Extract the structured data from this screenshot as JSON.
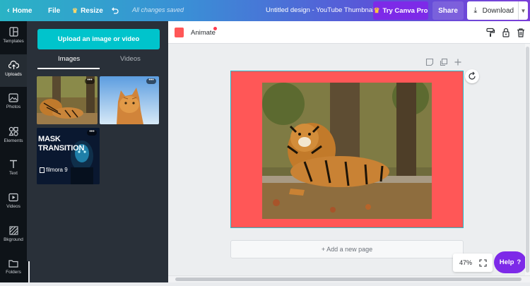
{
  "topbar": {
    "home_label": "Home",
    "file_label": "File",
    "resize_label": "Resize",
    "saved_status": "All changes saved",
    "design_title": "Untitled design - YouTube Thumbnail",
    "try_pro_label": "Try Canva Pro",
    "share_label": "Share",
    "download_label": "Download"
  },
  "sidenav": {
    "items": [
      {
        "label": "Templates",
        "icon": "templates-icon"
      },
      {
        "label": "Uploads",
        "icon": "upload-cloud-icon"
      },
      {
        "label": "Photos",
        "icon": "photos-icon"
      },
      {
        "label": "Elements",
        "icon": "elements-icon"
      },
      {
        "label": "Text",
        "icon": "text-icon"
      },
      {
        "label": "Videos",
        "icon": "videos-icon"
      },
      {
        "label": "Bkground",
        "icon": "background-icon"
      },
      {
        "label": "Folders",
        "icon": "folder-icon"
      }
    ]
  },
  "panel": {
    "upload_button": "Upload an image or video",
    "tabs": [
      "Images",
      "Videos"
    ],
    "active_tab": "Images",
    "thumbnails": [
      {
        "name": "tiger-thumbnail",
        "more": "•••"
      },
      {
        "name": "cat-thumbnail",
        "more": "•••"
      },
      {
        "name": "mask-transition-thumbnail",
        "more": "•••",
        "title": "MASK TRANSITION",
        "caption": "filmora 9"
      }
    ]
  },
  "editor": {
    "color_swatch": "#ff5757",
    "animate_label": "Animate",
    "canvas_background": "#ff5757",
    "add_page_label": "+ Add a new page",
    "zoom_label": "47%",
    "help_label": "Help",
    "help_icon": "?"
  },
  "colors": {
    "accent_teal": "#00c4cc",
    "pro_purple": "#7d2ae8",
    "sidebar_dark": "#0e1318",
    "panel_dark": "#293039"
  }
}
